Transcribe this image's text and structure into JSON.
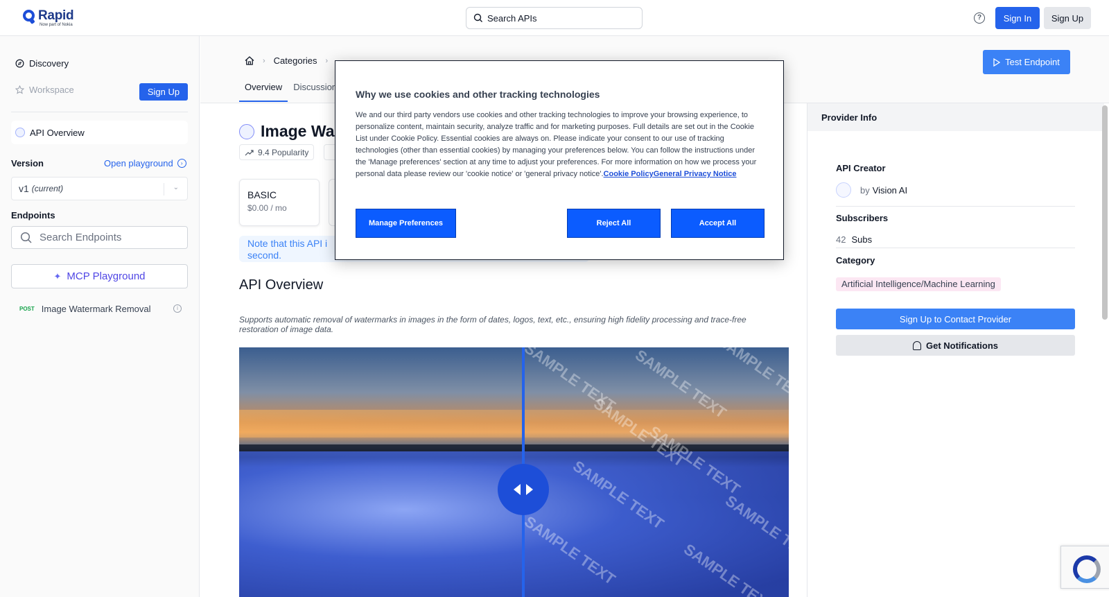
{
  "header": {
    "brand": "Rapid",
    "brand_sub": "Now part of Nokia",
    "search_placeholder": "Search APIs",
    "sign_in": "Sign In",
    "sign_up": "Sign Up"
  },
  "sidebar": {
    "discovery": "Discovery",
    "workspace": "Workspace",
    "sign_up": "Sign Up",
    "api_overview": "API Overview",
    "version_label": "Version",
    "open_playground": "Open playground",
    "version_value": "v1",
    "version_current": "(current)",
    "endpoints_label": "Endpoints",
    "search_endpoints_placeholder": "Search Endpoints",
    "mcp_playground": "MCP Playground",
    "endpoint_method": "POST",
    "endpoint_name": "Image Watermark Removal"
  },
  "main": {
    "breadcrumb": [
      "Categories",
      "Artificial Intelligence/Machine Learning",
      "Image Watermark Removal"
    ],
    "tabs": [
      "Overview",
      "Discussions"
    ],
    "test_endpoint": "Test Endpoint",
    "title": "Image Wa",
    "popularity": "9.4 Popularity",
    "plan_name": "BASIC",
    "plan_price": "$0.00 / mo",
    "note": "Note that this API i",
    "note_line2": "second.",
    "section_title": "API Overview",
    "description": "Supports automatic removal of watermarks in images in the form of dates, logos, text, etc., ensuring high fidelity processing and trace-free restoration of image data.",
    "watermark_text": "SAMPLE TEXT"
  },
  "right_panel": {
    "title": "Provider Info",
    "creator_label": "API Creator",
    "creator_by": "by",
    "creator_name": "Vision AI",
    "subscribers_label": "Subscribers",
    "subscribers_count": "42",
    "subscribers_unit": "Subs",
    "category_label": "Category",
    "category_value": "Artificial Intelligence/Machine Learning",
    "contact_button": "Sign Up to Contact Provider",
    "notify_button": "Get Notifications"
  },
  "cookie_modal": {
    "title": "Why we use cookies and other tracking technologies",
    "body": "We and our third party vendors use cookies and other tracking technologies to improve your browsing experience, to personalize content, maintain security, analyze traffic and for marketing purposes. Full details are set out in the Cookie List under Cookie Policy. Essential cookies are always on. Please indicate your consent to our use of tracking technologies (other than essential cookies) by managing your preferences below. You can follow the instructions under the 'Manage preferences' section at any time to adjust your preferences. For more information on how we process your personal data please review our 'cookie notice' or 'general privacy notice'.",
    "link_cookie_policy": "Cookie Policy",
    "link_privacy": "General Privacy Notice",
    "manage": "Manage Preferences",
    "reject": "Reject All",
    "accept": "Accept All"
  }
}
